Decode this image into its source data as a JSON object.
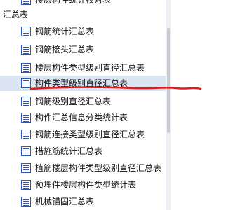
{
  "tree": {
    "partial_item_label": "楼层构件统计校对表",
    "group_label": "汇总表",
    "items": [
      {
        "label": "钢筋统计汇总表"
      },
      {
        "label": "钢筋接头汇总表"
      },
      {
        "label": "楼层构件类型级别直径汇总表"
      },
      {
        "label": "构件类型级别直径汇总表"
      },
      {
        "label": "钢筋级别直径汇总表"
      },
      {
        "label": "构件汇总信息分类统计表"
      },
      {
        "label": "钢筋连接类型级别直径汇总表"
      },
      {
        "label": "措施筋统计汇总表"
      },
      {
        "label": "植筋楼层构件类型级别直径汇总表"
      },
      {
        "label": "预埋件楼层构件类型统计表"
      },
      {
        "label": "机械锚固汇总表"
      }
    ],
    "selected_index": 3
  },
  "colors": {
    "icon": "#2f55b9",
    "selection": "#dbe4f1",
    "annotation_stroke": "#e21a1a"
  },
  "icons": {
    "item_icon": "document-icon"
  }
}
